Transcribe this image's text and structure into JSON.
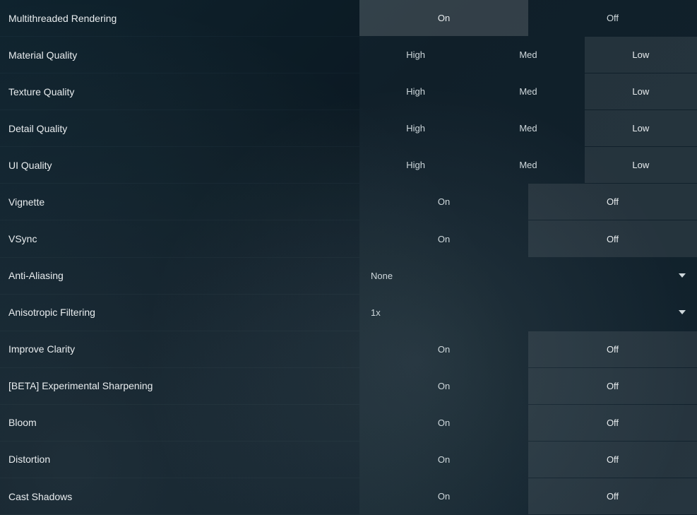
{
  "labels": {
    "on": "On",
    "off": "Off",
    "high": "High",
    "med": "Med",
    "low": "Low"
  },
  "rows": [
    {
      "label": "Multithreaded Rendering",
      "type": "onoff",
      "selected": "on",
      "strong": true
    },
    {
      "label": "Material Quality",
      "type": "hml",
      "selected": "low"
    },
    {
      "label": "Texture Quality",
      "type": "hml",
      "selected": "low"
    },
    {
      "label": "Detail Quality",
      "type": "hml",
      "selected": "low"
    },
    {
      "label": "UI Quality",
      "type": "hml",
      "selected": "low"
    },
    {
      "label": "Vignette",
      "type": "onoff",
      "selected": "off"
    },
    {
      "label": "VSync",
      "type": "onoff",
      "selected": "off"
    },
    {
      "label": "Anti-Aliasing",
      "type": "dropdown",
      "value": "None"
    },
    {
      "label": "Anisotropic Filtering",
      "type": "dropdown",
      "value": "1x"
    },
    {
      "label": "Improve Clarity",
      "type": "onoff",
      "selected": "off"
    },
    {
      "label": "[BETA] Experimental Sharpening",
      "type": "onoff",
      "selected": "off"
    },
    {
      "label": "Bloom",
      "type": "onoff",
      "selected": "off"
    },
    {
      "label": "Distortion",
      "type": "onoff",
      "selected": "off"
    },
    {
      "label": "Cast Shadows",
      "type": "onoff",
      "selected": "off"
    }
  ]
}
